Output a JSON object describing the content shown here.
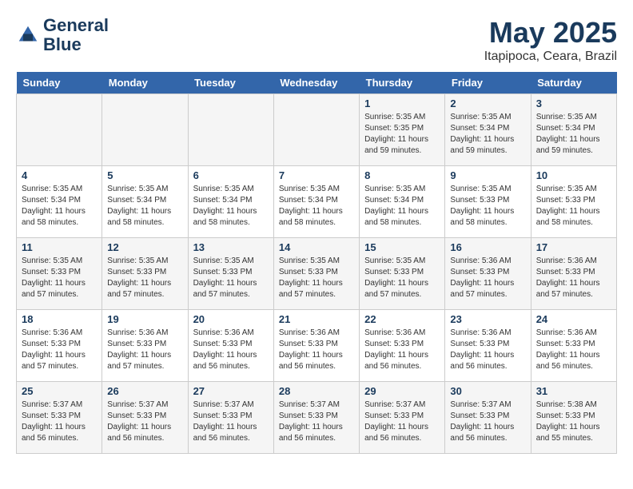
{
  "header": {
    "logo_line1": "General",
    "logo_line2": "Blue",
    "month": "May 2025",
    "location": "Itapipoca, Ceara, Brazil"
  },
  "weekdays": [
    "Sunday",
    "Monday",
    "Tuesday",
    "Wednesday",
    "Thursday",
    "Friday",
    "Saturday"
  ],
  "weeks": [
    [
      {
        "day": "",
        "info": ""
      },
      {
        "day": "",
        "info": ""
      },
      {
        "day": "",
        "info": ""
      },
      {
        "day": "",
        "info": ""
      },
      {
        "day": "1",
        "info": "Sunrise: 5:35 AM\nSunset: 5:35 PM\nDaylight: 11 hours\nand 59 minutes."
      },
      {
        "day": "2",
        "info": "Sunrise: 5:35 AM\nSunset: 5:34 PM\nDaylight: 11 hours\nand 59 minutes."
      },
      {
        "day": "3",
        "info": "Sunrise: 5:35 AM\nSunset: 5:34 PM\nDaylight: 11 hours\nand 59 minutes."
      }
    ],
    [
      {
        "day": "4",
        "info": "Sunrise: 5:35 AM\nSunset: 5:34 PM\nDaylight: 11 hours\nand 58 minutes."
      },
      {
        "day": "5",
        "info": "Sunrise: 5:35 AM\nSunset: 5:34 PM\nDaylight: 11 hours\nand 58 minutes."
      },
      {
        "day": "6",
        "info": "Sunrise: 5:35 AM\nSunset: 5:34 PM\nDaylight: 11 hours\nand 58 minutes."
      },
      {
        "day": "7",
        "info": "Sunrise: 5:35 AM\nSunset: 5:34 PM\nDaylight: 11 hours\nand 58 minutes."
      },
      {
        "day": "8",
        "info": "Sunrise: 5:35 AM\nSunset: 5:34 PM\nDaylight: 11 hours\nand 58 minutes."
      },
      {
        "day": "9",
        "info": "Sunrise: 5:35 AM\nSunset: 5:33 PM\nDaylight: 11 hours\nand 58 minutes."
      },
      {
        "day": "10",
        "info": "Sunrise: 5:35 AM\nSunset: 5:33 PM\nDaylight: 11 hours\nand 58 minutes."
      }
    ],
    [
      {
        "day": "11",
        "info": "Sunrise: 5:35 AM\nSunset: 5:33 PM\nDaylight: 11 hours\nand 57 minutes."
      },
      {
        "day": "12",
        "info": "Sunrise: 5:35 AM\nSunset: 5:33 PM\nDaylight: 11 hours\nand 57 minutes."
      },
      {
        "day": "13",
        "info": "Sunrise: 5:35 AM\nSunset: 5:33 PM\nDaylight: 11 hours\nand 57 minutes."
      },
      {
        "day": "14",
        "info": "Sunrise: 5:35 AM\nSunset: 5:33 PM\nDaylight: 11 hours\nand 57 minutes."
      },
      {
        "day": "15",
        "info": "Sunrise: 5:35 AM\nSunset: 5:33 PM\nDaylight: 11 hours\nand 57 minutes."
      },
      {
        "day": "16",
        "info": "Sunrise: 5:36 AM\nSunset: 5:33 PM\nDaylight: 11 hours\nand 57 minutes."
      },
      {
        "day": "17",
        "info": "Sunrise: 5:36 AM\nSunset: 5:33 PM\nDaylight: 11 hours\nand 57 minutes."
      }
    ],
    [
      {
        "day": "18",
        "info": "Sunrise: 5:36 AM\nSunset: 5:33 PM\nDaylight: 11 hours\nand 57 minutes."
      },
      {
        "day": "19",
        "info": "Sunrise: 5:36 AM\nSunset: 5:33 PM\nDaylight: 11 hours\nand 57 minutes."
      },
      {
        "day": "20",
        "info": "Sunrise: 5:36 AM\nSunset: 5:33 PM\nDaylight: 11 hours\nand 56 minutes."
      },
      {
        "day": "21",
        "info": "Sunrise: 5:36 AM\nSunset: 5:33 PM\nDaylight: 11 hours\nand 56 minutes."
      },
      {
        "day": "22",
        "info": "Sunrise: 5:36 AM\nSunset: 5:33 PM\nDaylight: 11 hours\nand 56 minutes."
      },
      {
        "day": "23",
        "info": "Sunrise: 5:36 AM\nSunset: 5:33 PM\nDaylight: 11 hours\nand 56 minutes."
      },
      {
        "day": "24",
        "info": "Sunrise: 5:36 AM\nSunset: 5:33 PM\nDaylight: 11 hours\nand 56 minutes."
      }
    ],
    [
      {
        "day": "25",
        "info": "Sunrise: 5:37 AM\nSunset: 5:33 PM\nDaylight: 11 hours\nand 56 minutes."
      },
      {
        "day": "26",
        "info": "Sunrise: 5:37 AM\nSunset: 5:33 PM\nDaylight: 11 hours\nand 56 minutes."
      },
      {
        "day": "27",
        "info": "Sunrise: 5:37 AM\nSunset: 5:33 PM\nDaylight: 11 hours\nand 56 minutes."
      },
      {
        "day": "28",
        "info": "Sunrise: 5:37 AM\nSunset: 5:33 PM\nDaylight: 11 hours\nand 56 minutes."
      },
      {
        "day": "29",
        "info": "Sunrise: 5:37 AM\nSunset: 5:33 PM\nDaylight: 11 hours\nand 56 minutes."
      },
      {
        "day": "30",
        "info": "Sunrise: 5:37 AM\nSunset: 5:33 PM\nDaylight: 11 hours\nand 56 minutes."
      },
      {
        "day": "31",
        "info": "Sunrise: 5:38 AM\nSunset: 5:33 PM\nDaylight: 11 hours\nand 55 minutes."
      }
    ]
  ]
}
